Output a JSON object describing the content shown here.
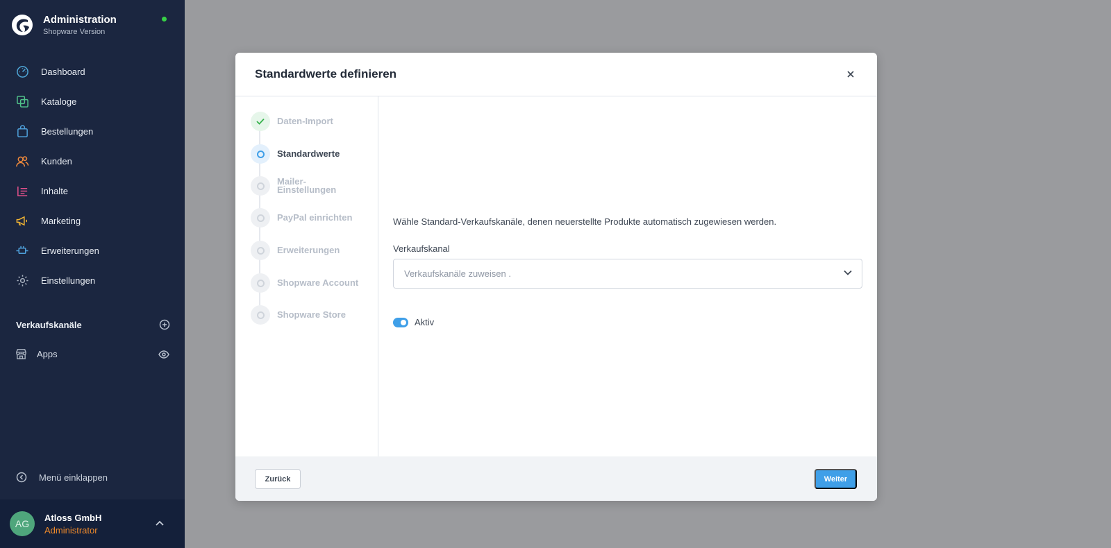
{
  "sidebar": {
    "brand": {
      "title": "Administration",
      "subtitle": "Shopware Version"
    },
    "items": [
      {
        "label": "Dashboard",
        "icon": "dashboard-icon",
        "color": "#4fa7d8"
      },
      {
        "label": "Kataloge",
        "icon": "catalog-icon",
        "color": "#50c28a"
      },
      {
        "label": "Bestellungen",
        "icon": "orders-bag-icon",
        "color": "#4e9fd9"
      },
      {
        "label": "Kunden",
        "icon": "customers-icon",
        "color": "#f08a3c"
      },
      {
        "label": "Inhalte",
        "icon": "content-icon",
        "color": "#e2508a"
      },
      {
        "label": "Marketing",
        "icon": "megaphone-icon",
        "color": "#f2b533"
      },
      {
        "label": "Erweiterungen",
        "icon": "plug-icon",
        "color": "#4e9fd9"
      },
      {
        "label": "Einstellungen",
        "icon": "gear-icon",
        "color": "#a8b1bf"
      }
    ],
    "sales_channels_label": "Verkaufskanäle",
    "apps_label": "Apps",
    "collapse_label": "Menü einklappen",
    "user": {
      "initials": "AG",
      "name": "Atloss GmbH",
      "role": "Administrator"
    }
  },
  "modal": {
    "title": "Standardwerte definieren",
    "steps": [
      {
        "label": "Daten-Import",
        "state": "done"
      },
      {
        "label": "Standardwerte",
        "state": "active"
      },
      {
        "label": "Mailer-\nEinstellungen",
        "state": "pending"
      },
      {
        "label": "PayPal einrichten",
        "state": "pending"
      },
      {
        "label": "Erweiterungen",
        "state": "pending"
      },
      {
        "label": "Shopware Account",
        "state": "pending"
      },
      {
        "label": "Shopware Store",
        "state": "pending"
      }
    ],
    "description": "Wähle Standard-Verkaufskanäle, denen neuerstellte Produkte automatisch zugewiesen werden.",
    "field_label": "Verkaufskanal",
    "select_placeholder": "Verkaufskanäle zuweisen .",
    "toggle_label": "Aktiv",
    "toggle_on": true,
    "back_label": "Zurück",
    "next_label": "Weiter"
  },
  "colors": {
    "sidebar_bg": "#1b2640",
    "accent": "#3f9fe8",
    "done": "#37b24d"
  }
}
